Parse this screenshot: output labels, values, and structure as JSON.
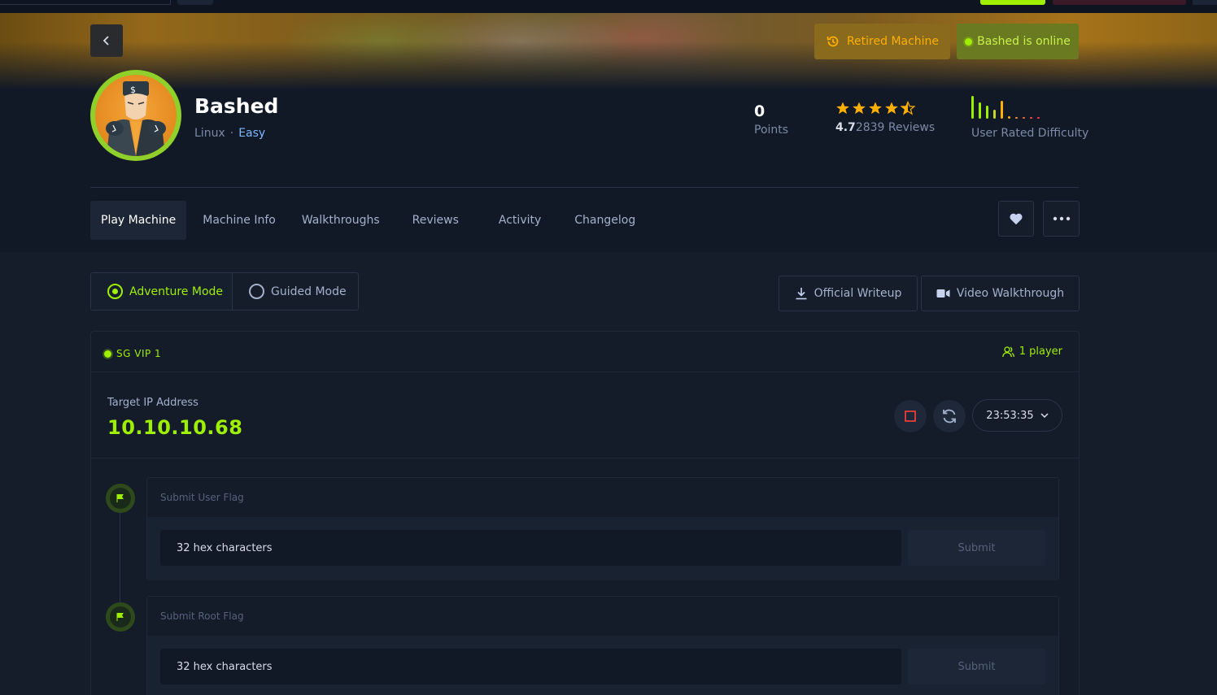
{
  "machine": {
    "name": "Bashed",
    "os": "Linux",
    "separator": "·",
    "difficulty": "Easy"
  },
  "badges": {
    "retired": "Retired Machine",
    "online": "Bashed is online"
  },
  "stats": {
    "points_value": "0",
    "points_label": "Points",
    "rating_value": "4.7",
    "rating_count": "2839 Reviews",
    "difficulty_label": "User Rated Difficulty"
  },
  "tabs": [
    {
      "label": "Play Machine"
    },
    {
      "label": "Machine Info"
    },
    {
      "label": "Walkthroughs"
    },
    {
      "label": "Reviews"
    },
    {
      "label": "Activity"
    },
    {
      "label": "Changelog"
    }
  ],
  "modes": {
    "adventure": "Adventure Mode",
    "guided": "Guided Mode"
  },
  "resources": {
    "writeup": "Official Writeup",
    "video": "Video Walkthrough"
  },
  "instance": {
    "server": "SG VIP 1",
    "players": "1 player",
    "target_label": "Target IP Address",
    "target_ip": "10.10.10.68",
    "timer": "23:53:35"
  },
  "flags": {
    "user_title": "Submit User Flag",
    "user_value": "32 hex characters",
    "root_title": "Submit Root Flag",
    "root_value": "32 hex characters",
    "submit_label": "Submit"
  },
  "colors": {
    "accent_green": "#9fef00",
    "retired_orange": "#ffaf00",
    "link_blue": "#7fb7ff",
    "background": "#151d2b"
  }
}
